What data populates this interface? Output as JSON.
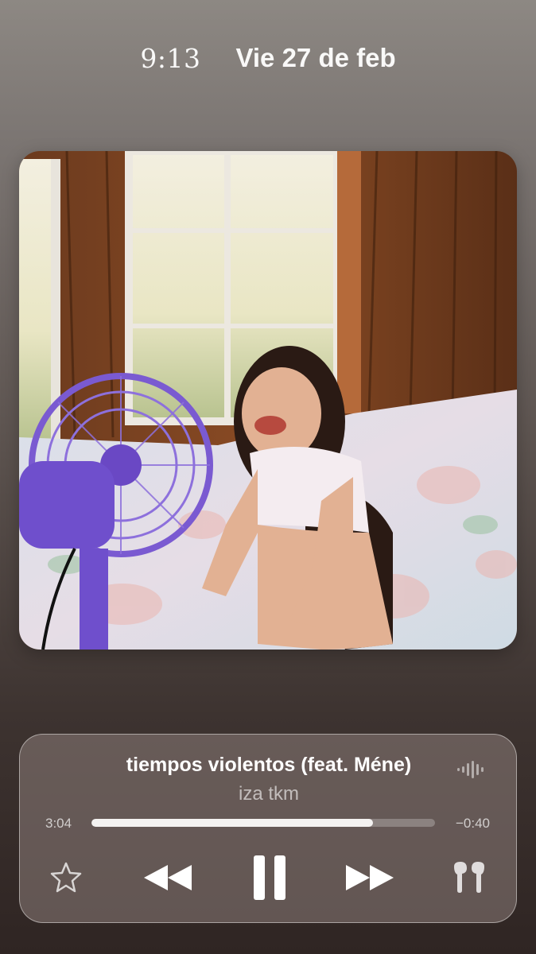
{
  "status": {
    "time": "9:13",
    "date": "Vie 27 de feb"
  },
  "artwork": {
    "icon": "album-artwork-photo"
  },
  "now_playing": {
    "title": "tiempos violentos (feat. Méne)",
    "artist": "iza tkm",
    "elapsed": "3:04",
    "remaining": "−0:40",
    "progress": 0.82
  },
  "controls": {
    "favorite_icon": "star-icon",
    "rewind_icon": "rewind-icon",
    "pause_icon": "pause-icon",
    "forward_icon": "fast-forward-icon",
    "output_icon": "airpods-icon",
    "waveform_icon": "waveform-icon"
  },
  "colors": {
    "accent_fan": "#7a5ad1",
    "progress_fill": "#f4f2f1"
  }
}
